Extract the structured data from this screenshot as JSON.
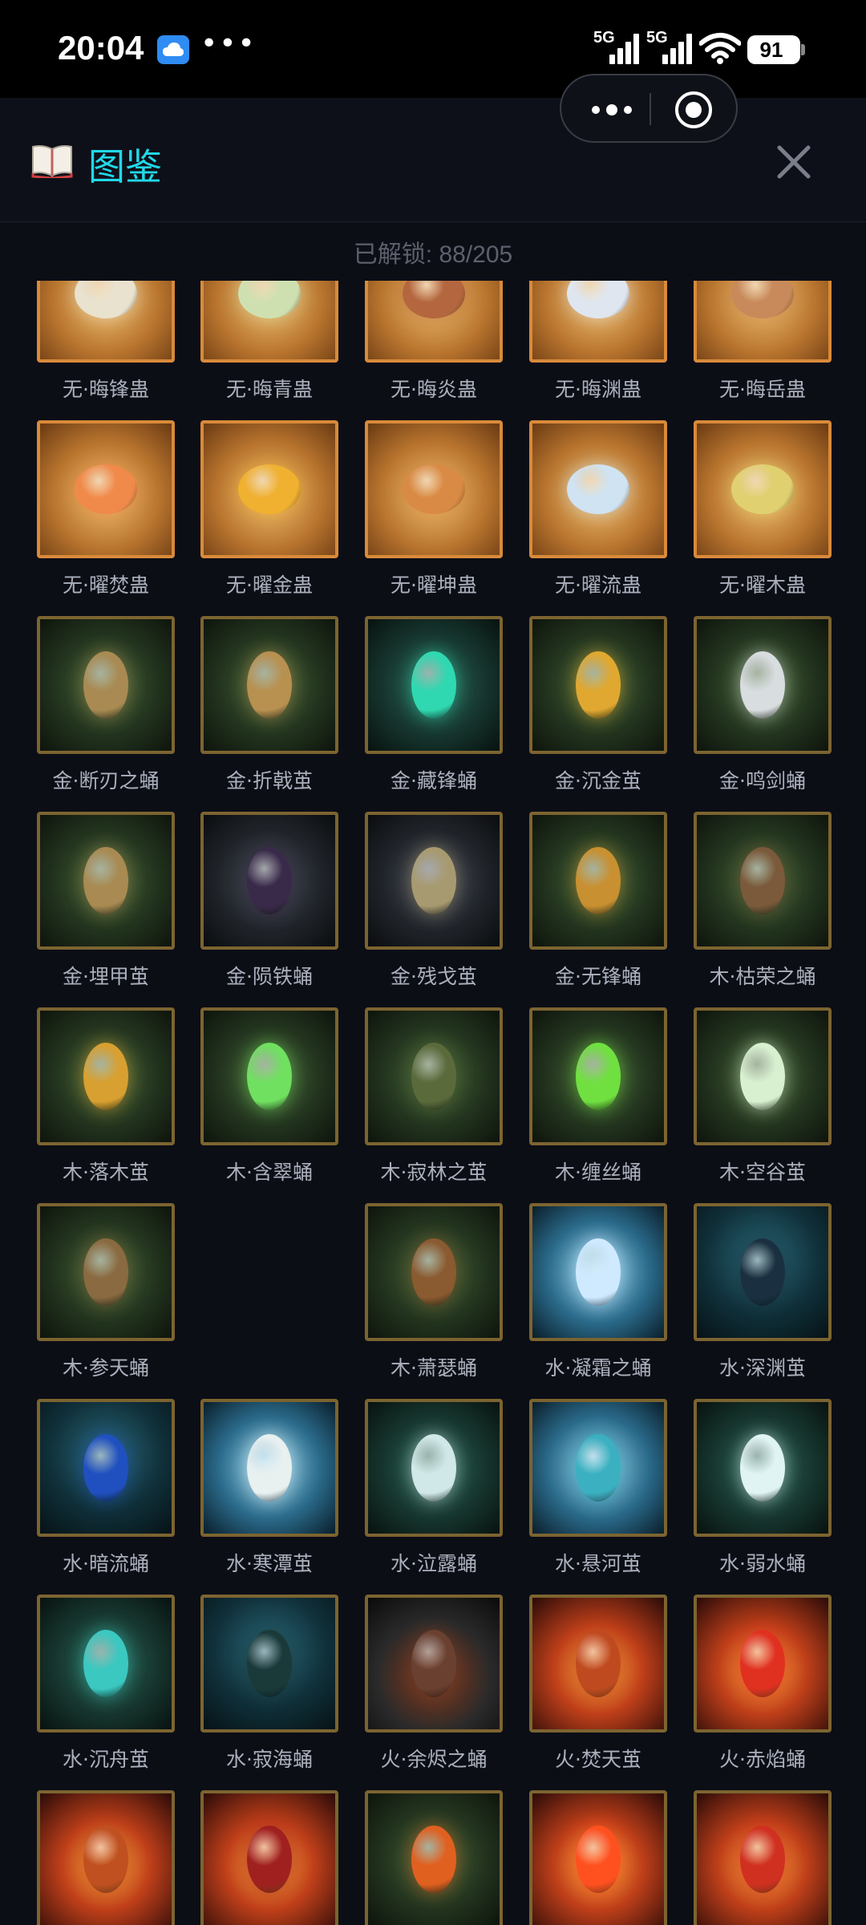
{
  "status": {
    "time": "20:04",
    "signal1": "5G",
    "signal2": "5G",
    "battery": "91"
  },
  "header": {
    "title": "图鉴",
    "unlock_text": "已解锁: 88/205"
  },
  "colors": {
    "accent": "#22d8e8",
    "orange_frame": "#d98a3a",
    "gold_frame": "#7c6430"
  },
  "items": [
    {
      "name": "无·晦锋蛊",
      "frame": "orange",
      "theme": "sand",
      "egg": "#e8e2cf"
    },
    {
      "name": "无·晦青蛊",
      "frame": "orange",
      "theme": "sand",
      "egg": "#cfe0b0"
    },
    {
      "name": "无·晦炎蛊",
      "frame": "orange",
      "theme": "sand",
      "egg": "#b4663e"
    },
    {
      "name": "无·晦渊蛊",
      "frame": "orange",
      "theme": "sand",
      "egg": "#dfe6f0"
    },
    {
      "name": "无·晦岳蛊",
      "frame": "orange",
      "theme": "sand",
      "egg": "#c88a5a"
    },
    {
      "name": "无·曜焚蛊",
      "frame": "orange",
      "theme": "sand",
      "egg": "#f08a4a"
    },
    {
      "name": "无·曜金蛊",
      "frame": "orange",
      "theme": "sand",
      "egg": "#f0b030"
    },
    {
      "name": "无·曜坤蛊",
      "frame": "orange",
      "theme": "sand",
      "egg": "#d98a44"
    },
    {
      "name": "无·曜流蛊",
      "frame": "orange",
      "theme": "sand",
      "egg": "#cfe3f2"
    },
    {
      "name": "无·曜木蛊",
      "frame": "orange",
      "theme": "sand",
      "egg": "#e0d070"
    },
    {
      "name": "金·断刃之蛹",
      "frame": "gold",
      "theme": "forest",
      "egg": "#a88a52"
    },
    {
      "name": "金·折戟茧",
      "frame": "gold",
      "theme": "forest",
      "egg": "#b89050"
    },
    {
      "name": "金·藏锋蛹",
      "frame": "gold",
      "theme": "teal",
      "egg": "#2fd8b0"
    },
    {
      "name": "金·沉金茧",
      "frame": "gold",
      "theme": "forest",
      "egg": "#e0a830"
    },
    {
      "name": "金·鸣剑蛹",
      "frame": "gold",
      "theme": "forest",
      "egg": "#d8dde0"
    },
    {
      "name": "金·埋甲茧",
      "frame": "gold",
      "theme": "forest",
      "egg": "#a88a52"
    },
    {
      "name": "金·陨铁蛹",
      "frame": "gold",
      "theme": "dark",
      "egg": "#3a2a4a"
    },
    {
      "name": "金·残戈茧",
      "frame": "gold",
      "theme": "dark",
      "egg": "#a89a70"
    },
    {
      "name": "金·无锋蛹",
      "frame": "gold",
      "theme": "forest",
      "egg": "#c89030"
    },
    {
      "name": "木·枯荣之蛹",
      "frame": "gold",
      "theme": "forest",
      "egg": "#7a5a3a"
    },
    {
      "name": "木·落木茧",
      "frame": "gold",
      "theme": "forest",
      "egg": "#d8a030"
    },
    {
      "name": "木·含翠蛹",
      "frame": "gold",
      "theme": "forest",
      "egg": "#70e060"
    },
    {
      "name": "木·寂林之茧",
      "frame": "gold",
      "theme": "forest",
      "egg": "#5a6a3a"
    },
    {
      "name": "木·缠丝蛹",
      "frame": "gold",
      "theme": "forest",
      "egg": "#70e040"
    },
    {
      "name": "木·空谷茧",
      "frame": "gold",
      "theme": "forest",
      "egg": "#d8f0d0"
    },
    {
      "name": "木·参天蛹",
      "frame": "gold",
      "theme": "forest",
      "egg": "#8a6a40"
    },
    {
      "name": "",
      "frame": "none",
      "theme": "empty",
      "egg": ""
    },
    {
      "name": "木·萧瑟蛹",
      "frame": "gold",
      "theme": "forest",
      "egg": "#8a5a30"
    },
    {
      "name": "水·凝霜之蛹",
      "frame": "gold",
      "theme": "ice",
      "egg": "#cfeaff"
    },
    {
      "name": "水·深渊茧",
      "frame": "gold",
      "theme": "deepsea",
      "egg": "#1a3040"
    },
    {
      "name": "水·暗流蛹",
      "frame": "gold",
      "theme": "deepsea",
      "egg": "#2050c0"
    },
    {
      "name": "水·寒潭茧",
      "frame": "gold",
      "theme": "ice",
      "egg": "#e8f0f0"
    },
    {
      "name": "水·泣露蛹",
      "frame": "gold",
      "theme": "teal",
      "egg": "#d0e8e8"
    },
    {
      "name": "水·悬河茧",
      "frame": "gold",
      "theme": "ice",
      "egg": "#3ab0c0"
    },
    {
      "name": "水·弱水蛹",
      "frame": "gold",
      "theme": "teal",
      "egg": "#e0f4f4"
    },
    {
      "name": "水·沉舟茧",
      "frame": "gold",
      "theme": "teal",
      "egg": "#3ac8c0"
    },
    {
      "name": "水·寂海蛹",
      "frame": "gold",
      "theme": "deepsea",
      "egg": "#1a3a3a"
    },
    {
      "name": "火·余烬之蛹",
      "frame": "gold",
      "theme": "ember",
      "egg": "#6a4030"
    },
    {
      "name": "火·焚天茧",
      "frame": "gold",
      "theme": "fire",
      "egg": "#c04a20"
    },
    {
      "name": "火·赤焰蛹",
      "frame": "gold",
      "theme": "fire",
      "egg": "#e03020"
    },
    {
      "name": "",
      "frame": "gold",
      "theme": "fire",
      "egg": "#c05020"
    },
    {
      "name": "",
      "frame": "gold",
      "theme": "fire",
      "egg": "#a02020"
    },
    {
      "name": "",
      "frame": "gold",
      "theme": "forest",
      "egg": "#e06020"
    },
    {
      "name": "",
      "frame": "gold",
      "theme": "fire",
      "egg": "#ff5020"
    },
    {
      "name": "",
      "frame": "gold",
      "theme": "fire",
      "egg": "#d03020"
    }
  ]
}
